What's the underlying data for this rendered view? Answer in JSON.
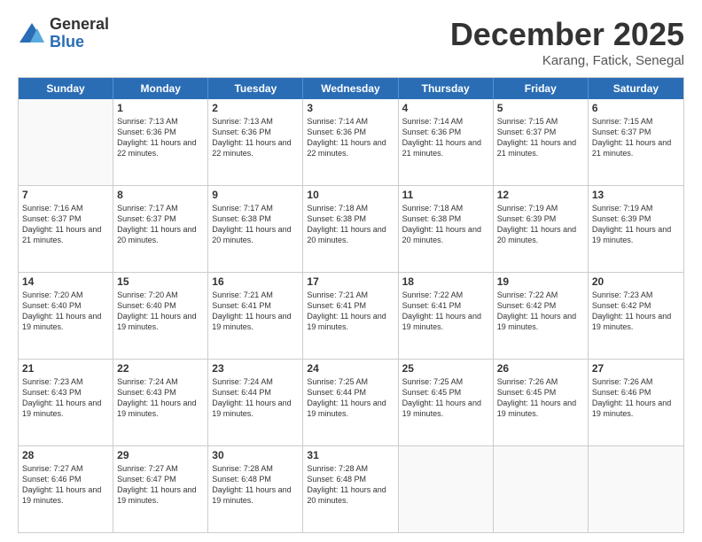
{
  "logo": {
    "general": "General",
    "blue": "Blue"
  },
  "header": {
    "month": "December 2025",
    "location": "Karang, Fatick, Senegal"
  },
  "days": [
    "Sunday",
    "Monday",
    "Tuesday",
    "Wednesday",
    "Thursday",
    "Friday",
    "Saturday"
  ],
  "weeks": [
    [
      {
        "num": "",
        "empty": true
      },
      {
        "num": "1",
        "sunrise": "7:13 AM",
        "sunset": "6:36 PM",
        "daylight": "11 hours and 22 minutes."
      },
      {
        "num": "2",
        "sunrise": "7:13 AM",
        "sunset": "6:36 PM",
        "daylight": "11 hours and 22 minutes."
      },
      {
        "num": "3",
        "sunrise": "7:14 AM",
        "sunset": "6:36 PM",
        "daylight": "11 hours and 22 minutes."
      },
      {
        "num": "4",
        "sunrise": "7:14 AM",
        "sunset": "6:36 PM",
        "daylight": "11 hours and 21 minutes."
      },
      {
        "num": "5",
        "sunrise": "7:15 AM",
        "sunset": "6:37 PM",
        "daylight": "11 hours and 21 minutes."
      },
      {
        "num": "6",
        "sunrise": "7:15 AM",
        "sunset": "6:37 PM",
        "daylight": "11 hours and 21 minutes."
      }
    ],
    [
      {
        "num": "7",
        "sunrise": "7:16 AM",
        "sunset": "6:37 PM",
        "daylight": "11 hours and 21 minutes."
      },
      {
        "num": "8",
        "sunrise": "7:17 AM",
        "sunset": "6:37 PM",
        "daylight": "11 hours and 20 minutes."
      },
      {
        "num": "9",
        "sunrise": "7:17 AM",
        "sunset": "6:38 PM",
        "daylight": "11 hours and 20 minutes."
      },
      {
        "num": "10",
        "sunrise": "7:18 AM",
        "sunset": "6:38 PM",
        "daylight": "11 hours and 20 minutes."
      },
      {
        "num": "11",
        "sunrise": "7:18 AM",
        "sunset": "6:38 PM",
        "daylight": "11 hours and 20 minutes."
      },
      {
        "num": "12",
        "sunrise": "7:19 AM",
        "sunset": "6:39 PM",
        "daylight": "11 hours and 20 minutes."
      },
      {
        "num": "13",
        "sunrise": "7:19 AM",
        "sunset": "6:39 PM",
        "daylight": "11 hours and 19 minutes."
      }
    ],
    [
      {
        "num": "14",
        "sunrise": "7:20 AM",
        "sunset": "6:40 PM",
        "daylight": "11 hours and 19 minutes."
      },
      {
        "num": "15",
        "sunrise": "7:20 AM",
        "sunset": "6:40 PM",
        "daylight": "11 hours and 19 minutes."
      },
      {
        "num": "16",
        "sunrise": "7:21 AM",
        "sunset": "6:41 PM",
        "daylight": "11 hours and 19 minutes."
      },
      {
        "num": "17",
        "sunrise": "7:21 AM",
        "sunset": "6:41 PM",
        "daylight": "11 hours and 19 minutes."
      },
      {
        "num": "18",
        "sunrise": "7:22 AM",
        "sunset": "6:41 PM",
        "daylight": "11 hours and 19 minutes."
      },
      {
        "num": "19",
        "sunrise": "7:22 AM",
        "sunset": "6:42 PM",
        "daylight": "11 hours and 19 minutes."
      },
      {
        "num": "20",
        "sunrise": "7:23 AM",
        "sunset": "6:42 PM",
        "daylight": "11 hours and 19 minutes."
      }
    ],
    [
      {
        "num": "21",
        "sunrise": "7:23 AM",
        "sunset": "6:43 PM",
        "daylight": "11 hours and 19 minutes."
      },
      {
        "num": "22",
        "sunrise": "7:24 AM",
        "sunset": "6:43 PM",
        "daylight": "11 hours and 19 minutes."
      },
      {
        "num": "23",
        "sunrise": "7:24 AM",
        "sunset": "6:44 PM",
        "daylight": "11 hours and 19 minutes."
      },
      {
        "num": "24",
        "sunrise": "7:25 AM",
        "sunset": "6:44 PM",
        "daylight": "11 hours and 19 minutes."
      },
      {
        "num": "25",
        "sunrise": "7:25 AM",
        "sunset": "6:45 PM",
        "daylight": "11 hours and 19 minutes."
      },
      {
        "num": "26",
        "sunrise": "7:26 AM",
        "sunset": "6:45 PM",
        "daylight": "11 hours and 19 minutes."
      },
      {
        "num": "27",
        "sunrise": "7:26 AM",
        "sunset": "6:46 PM",
        "daylight": "11 hours and 19 minutes."
      }
    ],
    [
      {
        "num": "28",
        "sunrise": "7:27 AM",
        "sunset": "6:46 PM",
        "daylight": "11 hours and 19 minutes."
      },
      {
        "num": "29",
        "sunrise": "7:27 AM",
        "sunset": "6:47 PM",
        "daylight": "11 hours and 19 minutes."
      },
      {
        "num": "30",
        "sunrise": "7:28 AM",
        "sunset": "6:48 PM",
        "daylight": "11 hours and 19 minutes."
      },
      {
        "num": "31",
        "sunrise": "7:28 AM",
        "sunset": "6:48 PM",
        "daylight": "11 hours and 20 minutes."
      },
      {
        "num": "",
        "empty": true
      },
      {
        "num": "",
        "empty": true
      },
      {
        "num": "",
        "empty": true
      }
    ]
  ]
}
